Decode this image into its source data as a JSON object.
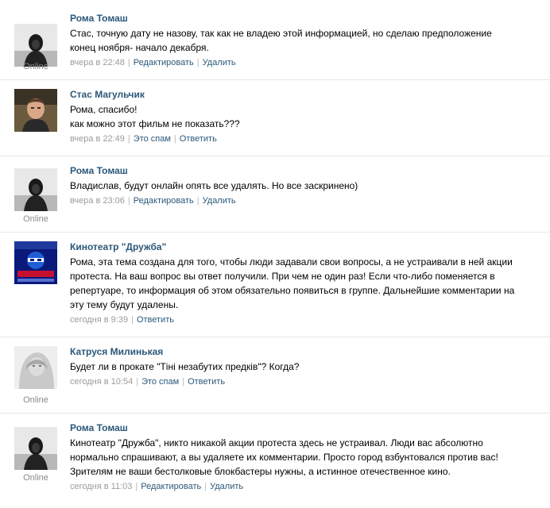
{
  "posts": [
    {
      "author": "Рома Томаш",
      "online": "Online",
      "avatar": "dark-hooded-person-icon",
      "lines": [
        "Стас, точную дату не назову, так как не владею этой информацией, но сделаю предположение",
        "конец ноября- начало декабря."
      ],
      "time": "вчера в 22:48",
      "actions": [
        "Редактировать",
        "Удалить"
      ]
    },
    {
      "author": "Стас Магульчик",
      "avatar": "young-man-photo-icon",
      "lines": [
        "Рома, спасибо!",
        "как можно этот фильм не показать???"
      ],
      "time": "вчера в 22:49",
      "actions": [
        "Это спам",
        "Ответить"
      ]
    },
    {
      "author": "Рома Томаш",
      "online": "Online",
      "avatar": "dark-hooded-person-icon",
      "lines": [
        "Владислав, будут онлайн опять все удалять. Но все заскринено)"
      ],
      "time": "вчера в 23:06",
      "actions": [
        "Редактировать",
        "Удалить"
      ]
    },
    {
      "author": "Кинотеатр \"Дружба\"",
      "avatar": "cinema-logo-icon",
      "lines": [
        "Рома, эта тема создана для того, чтобы люди задавали свои вопросы, а не устраивали в ней акции",
        "протеста. На ваш вопрос вы ответ получили. При чем не один раз! Если что-либо поменяется в",
        "репертуаре, то информация об этом обязательно появиться в группе. Дальнейшие комментарии на",
        "эту тему будут удалены."
      ],
      "time": "сегодня в 9:39",
      "actions": [
        "Ответить"
      ]
    },
    {
      "author": "Катруся Милинькая",
      "online": "Online",
      "avatar": "woman-photo-icon",
      "lines": [
        "Будет ли в прокате \"Тіні незабутих предків\"? Когда?"
      ],
      "time": "сегодня в 10:54",
      "actions": [
        "Это спам",
        "Ответить"
      ]
    },
    {
      "author": "Рома Томаш",
      "online": "Online",
      "avatar": "dark-hooded-person-icon",
      "lines": [
        "Кинотеатр \"Дружба\", никто никакой акции протеста здесь не устраивал. Люди вас абсолютно",
        "нормально спрашивают, а вы удаляете их комментарии. Просто город взбунтовался против вас!",
        "Зрителям не ваши бестолковые блокбастеры нужны, а истинное отечественное кино."
      ],
      "time": "сегодня в 11:03",
      "actions": [
        "Редактировать",
        "Удалить"
      ]
    }
  ]
}
